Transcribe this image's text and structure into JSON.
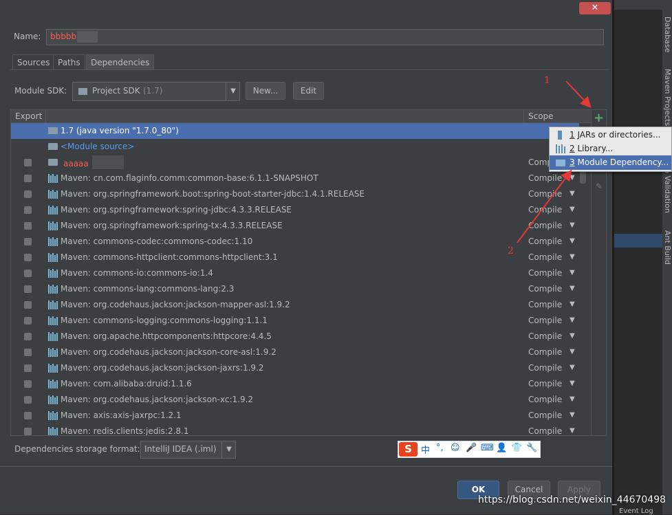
{
  "window": {
    "close_icon": "close-icon"
  },
  "name_field": {
    "label": "Name:",
    "value": "bbbbb"
  },
  "tabs": [
    {
      "label": "Sources"
    },
    {
      "label": "Paths"
    },
    {
      "label": "Dependencies",
      "active": true
    }
  ],
  "sdk": {
    "label": "Module SDK:",
    "value": "Project SDK",
    "value_detail": "(1.7)",
    "new_button": "New...",
    "edit_button": "Edit"
  },
  "table": {
    "headers": {
      "export": "Export",
      "scope": "Scope"
    },
    "add_icon": "+",
    "rows": [
      {
        "text": "1.7 (java version \"1.7.0_80\")",
        "icon": "folder-icon",
        "checkbox": false,
        "scope": "",
        "selected": true
      },
      {
        "text": "<Module source>",
        "icon": "folder-icon",
        "checkbox": false,
        "scope": "",
        "link": true
      },
      {
        "text": "aaaaa",
        "icon": "folder-icon",
        "checkbox": true,
        "scope": "Compile",
        "red": true
      },
      {
        "text": "Maven: cn.com.flaginfo.comm:common-base:6.1.1-SNAPSHOT",
        "icon": "library-icon",
        "checkbox": true,
        "scope": "Compile"
      },
      {
        "text": "Maven: org.springframework.boot:spring-boot-starter-jdbc:1.4.1.RELEASE",
        "icon": "library-icon",
        "checkbox": true,
        "scope": "Compile"
      },
      {
        "text": "Maven: org.springframework:spring-jdbc:4.3.3.RELEASE",
        "icon": "library-icon",
        "checkbox": true,
        "scope": "Compile"
      },
      {
        "text": "Maven: org.springframework:spring-tx:4.3.3.RELEASE",
        "icon": "library-icon",
        "checkbox": true,
        "scope": "Compile"
      },
      {
        "text": "Maven: commons-codec:commons-codec:1.10",
        "icon": "library-icon",
        "checkbox": true,
        "scope": "Compile"
      },
      {
        "text": "Maven: commons-httpclient:commons-httpclient:3.1",
        "icon": "library-icon",
        "checkbox": true,
        "scope": "Compile"
      },
      {
        "text": "Maven: commons-io:commons-io:1.4",
        "icon": "library-icon",
        "checkbox": true,
        "scope": "Compile"
      },
      {
        "text": "Maven: commons-lang:commons-lang:2.3",
        "icon": "library-icon",
        "checkbox": true,
        "scope": "Compile"
      },
      {
        "text": "Maven: org.codehaus.jackson:jackson-mapper-asl:1.9.2",
        "icon": "library-icon",
        "checkbox": true,
        "scope": "Compile"
      },
      {
        "text": "Maven: commons-logging:commons-logging:1.1.1",
        "icon": "library-icon",
        "checkbox": true,
        "scope": "Compile"
      },
      {
        "text": "Maven: org.apache.httpcomponents:httpcore:4.4.5",
        "icon": "library-icon",
        "checkbox": true,
        "scope": "Compile"
      },
      {
        "text": "Maven: org.codehaus.jackson:jackson-core-asl:1.9.2",
        "icon": "library-icon",
        "checkbox": true,
        "scope": "Compile"
      },
      {
        "text": "Maven: org.codehaus.jackson:jackson-jaxrs:1.9.2",
        "icon": "library-icon",
        "checkbox": true,
        "scope": "Compile"
      },
      {
        "text": "Maven: com.alibaba:druid:1.1.6",
        "icon": "library-icon",
        "checkbox": true,
        "scope": "Compile"
      },
      {
        "text": "Maven: org.codehaus.jackson:jackson-xc:1.9.2",
        "icon": "library-icon",
        "checkbox": true,
        "scope": "Compile"
      },
      {
        "text": "Maven: axis:axis-jaxrpc:1.2.1",
        "icon": "library-icon",
        "checkbox": true,
        "scope": "Compile"
      },
      {
        "text": "Maven: redis.clients:jedis:2.8.1",
        "icon": "library-icon",
        "checkbox": true,
        "scope": "Compile"
      }
    ]
  },
  "popup": {
    "items": [
      {
        "num": "1",
        "label": "JARs or directories...",
        "icon": "jar-icon"
      },
      {
        "num": "2",
        "label": "Library...",
        "icon": "library-icon"
      },
      {
        "num": "3",
        "label": "Module Dependency...",
        "icon": "module-icon",
        "selected": true
      }
    ]
  },
  "storage": {
    "label": "Dependencies storage format:",
    "value": "IntelliJ IDEA (.iml)"
  },
  "footer": {
    "ok": "OK",
    "cancel": "Cancel",
    "apply": "Apply"
  },
  "annotations": {
    "one": "1",
    "two": "2"
  },
  "right_tool_tabs": {
    "database": "Database",
    "maven": "Maven Projects",
    "validation": "n Validation",
    "ant": "Ant Build",
    "event_log": "Event Log"
  },
  "ime_bar": {
    "logo": "S",
    "items": [
      "中",
      "°,",
      "☺",
      "🎤",
      "⌨",
      "👤",
      "👕",
      "🔧"
    ]
  },
  "watermark": "https://blog.csdn.net/weixin_44670498",
  "colors": {
    "selection": "#4b6eaf",
    "annotation": "#e53935",
    "link": "#589df6",
    "add": "#59a869"
  }
}
